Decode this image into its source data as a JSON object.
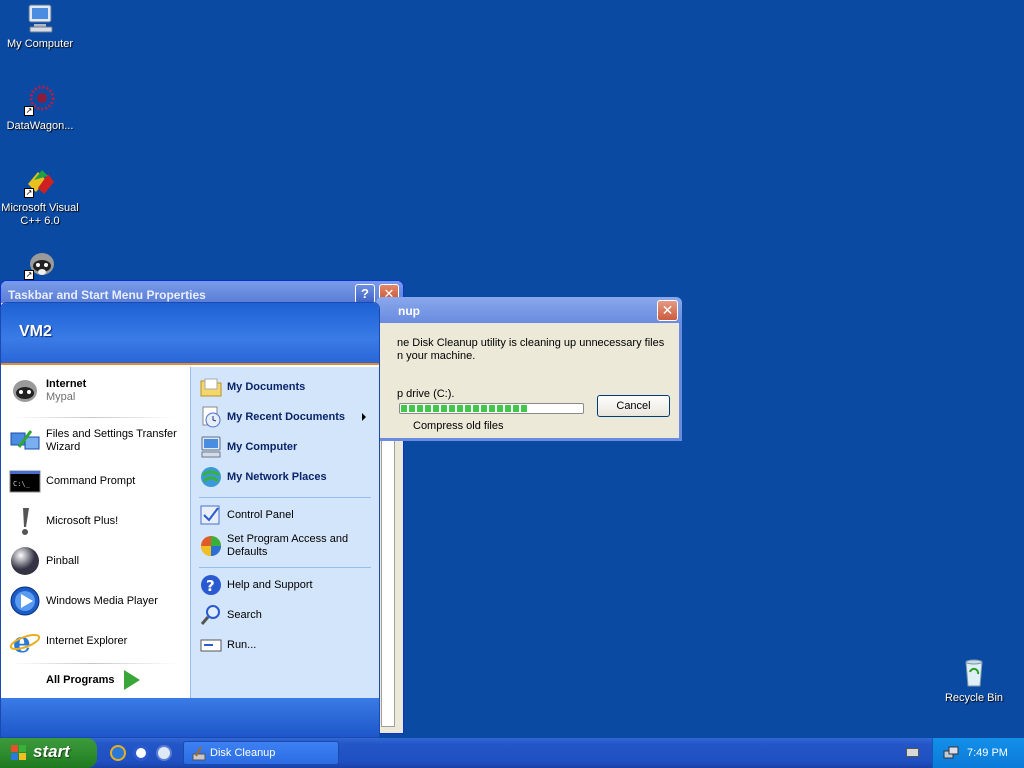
{
  "desktop": {
    "icons": [
      {
        "label": "My Computer",
        "icon": "my-computer-icon"
      },
      {
        "label": "DataWagon...",
        "icon": "datawagon-icon"
      },
      {
        "label": "Microsoft Visual\nC++ 6.0",
        "icon": "visual-cpp-icon"
      },
      {
        "label": "",
        "icon": "raccoon-icon"
      },
      {
        "label": "Recycle Bin",
        "icon": "recycle-bin-icon"
      }
    ]
  },
  "props_window": {
    "title": "Taskbar and Start Menu Properties",
    "help_label": "?",
    "close_label": "✕"
  },
  "disk_cleanup": {
    "title_fragment": "nup",
    "close_label": "✕",
    "message": "ne Disk Cleanup utility is cleaning up unnecessary files\nn your machine.",
    "drive_text": "p drive  (C:).",
    "progress_percent": 70,
    "cancel_label": "Cancel",
    "status_text": "Compress old files"
  },
  "start_menu": {
    "user": "VM2",
    "pinned": [
      {
        "title": "Internet",
        "subtitle": "Mypal"
      }
    ],
    "left_items": [
      {
        "label": "Files and Settings Transfer\nWizard"
      },
      {
        "label": "Command Prompt"
      },
      {
        "label": "Microsoft Plus!"
      },
      {
        "label": "Pinball"
      },
      {
        "label": "Windows Media Player"
      },
      {
        "label": "Internet Explorer"
      }
    ],
    "all_programs": "All Programs",
    "right_items": [
      {
        "label": "My Documents"
      },
      {
        "label": "My Recent Documents"
      },
      {
        "label": "My Computer"
      },
      {
        "label": "My Network Places"
      },
      {
        "label": "Control Panel"
      },
      {
        "label": "Set Program Access and\nDefaults"
      },
      {
        "label": "Help and Support"
      },
      {
        "label": "Search"
      },
      {
        "label": "Run..."
      }
    ]
  },
  "taskbar": {
    "start_label": "start",
    "task_button": "Disk Cleanup",
    "clock": "7:49 PM"
  },
  "colors": {
    "desktop": "#0b4aa2",
    "taskbar": "#2456c7",
    "start_button": "#2f8c2f",
    "accent_orange": "#e58b2c"
  }
}
